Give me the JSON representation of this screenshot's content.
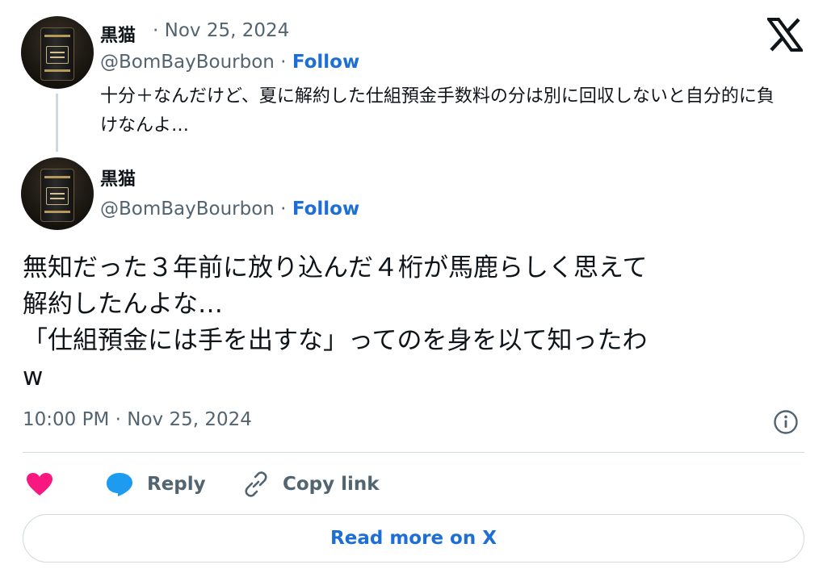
{
  "reply_tweet": {
    "author_name": "黒猫",
    "date": "· Nov 25, 2024",
    "handle": "@BomBayBourbon",
    "separator": " · ",
    "follow_label": "Follow",
    "text": "十分＋なんだけど、夏に解約した仕組預金手数料の分は別に回収しないと自分的に負けなんよ…"
  },
  "main_tweet": {
    "author_name": "黒猫",
    "handle": "@BomBayBourbon",
    "separator": " · ",
    "follow_label": "Follow",
    "text": "無知だった３年前に放り込んだ４桁が馬鹿らしく思えて\n解約したんよな…\n「仕組預金には手を出すな」ってのを身を以て知ったわ\nw",
    "timestamp": "10:00 PM · Nov 25, 2024"
  },
  "actions": {
    "like_icon": "heart-icon",
    "reply_label": "Reply",
    "reply_icon": "speech-bubble-icon",
    "copy_label": "Copy link",
    "copy_icon": "link-icon"
  },
  "read_more_label": "Read more on X",
  "colors": {
    "accent": "#1d6fd6",
    "like": "#f91880",
    "reply_icon": "#1d9bf0",
    "muted": "#536471",
    "border": "#cfd9de"
  }
}
